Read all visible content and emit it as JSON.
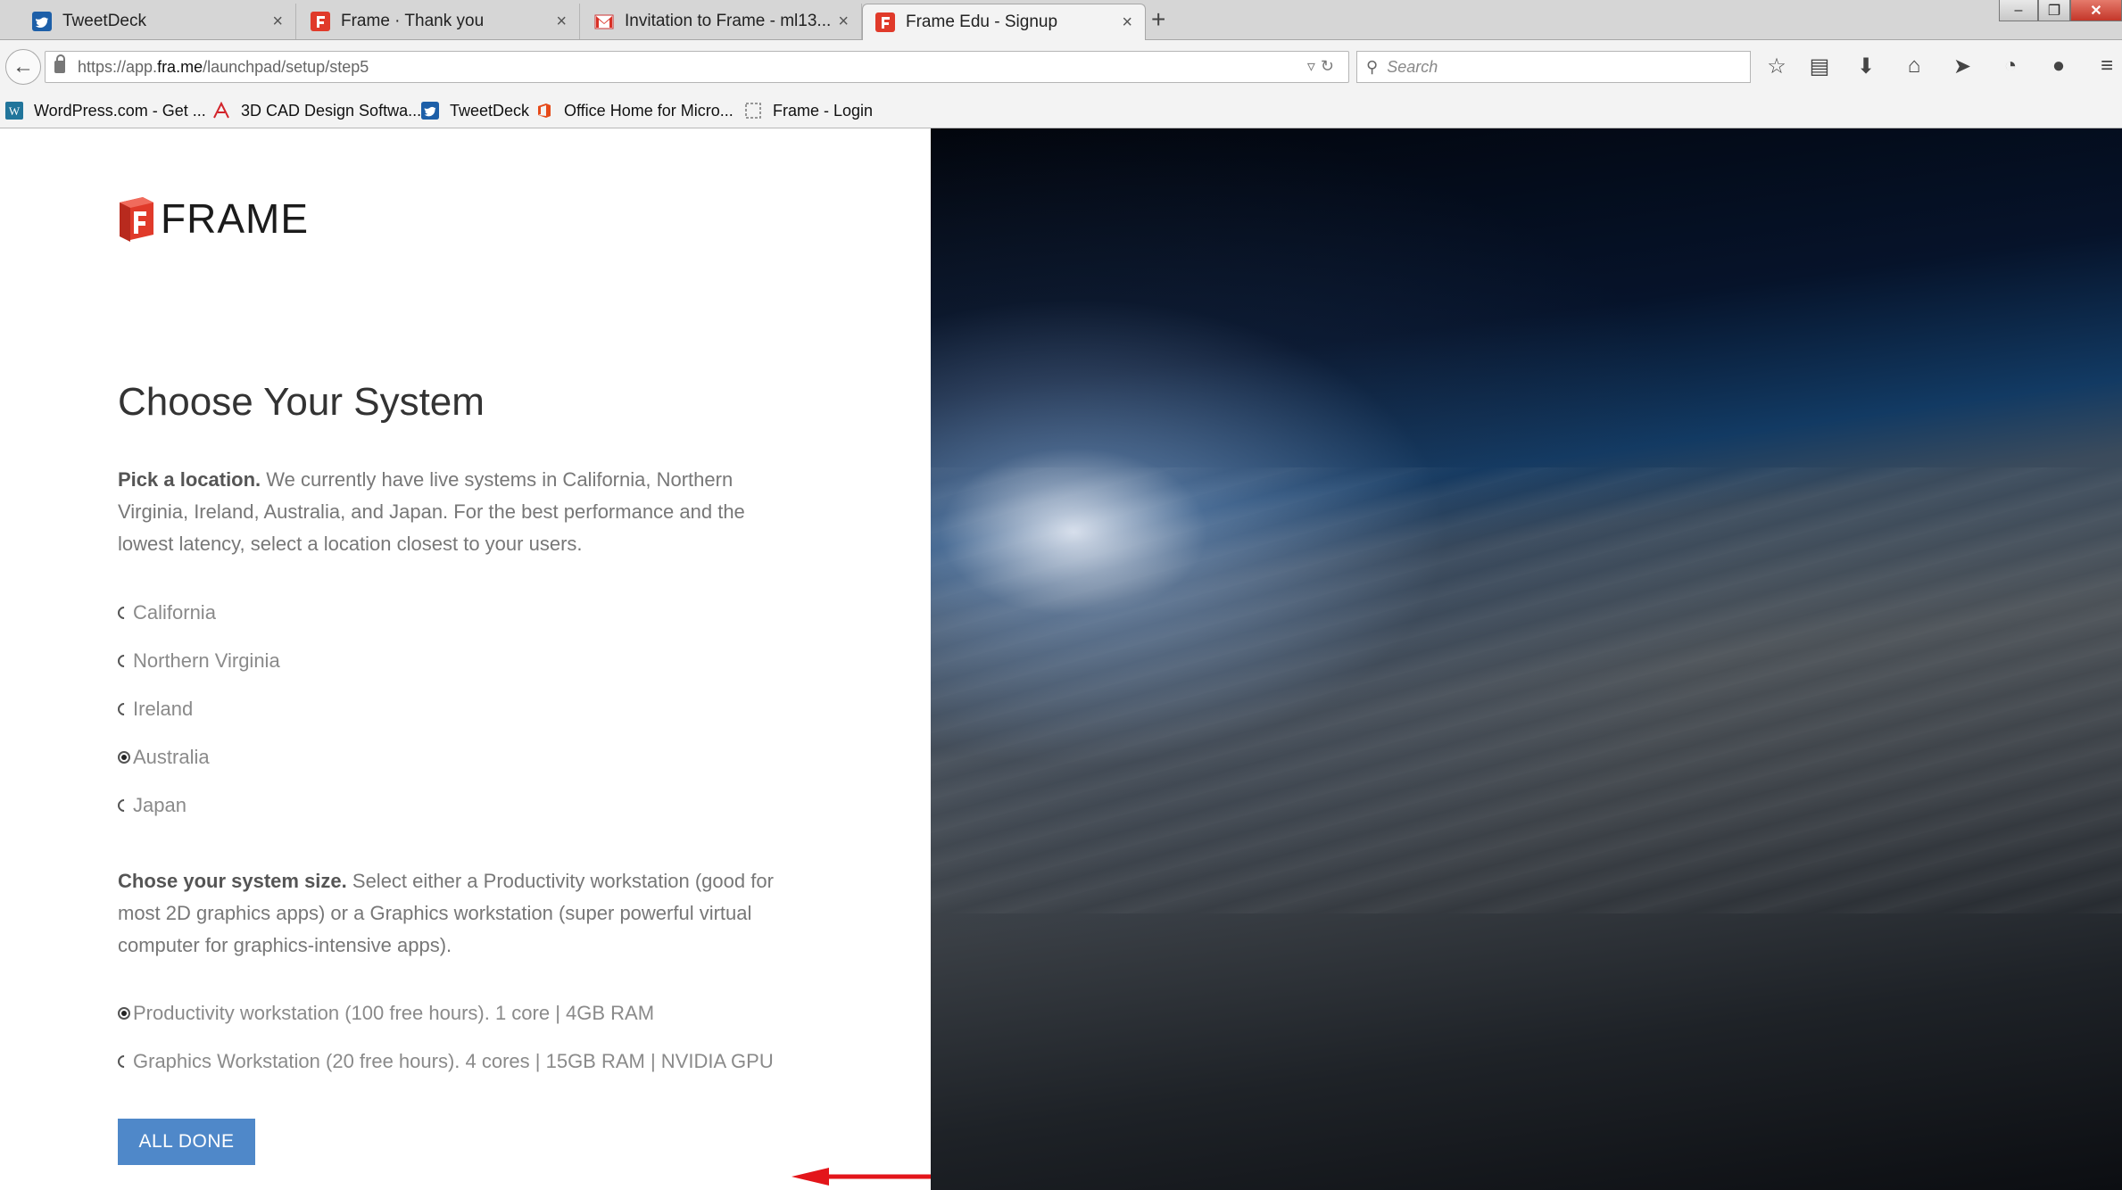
{
  "tabs": [
    {
      "label": "TweetDeck",
      "icon": "tweetdeck-icon",
      "active": false
    },
    {
      "label": "Frame · Thank you",
      "icon": "frame-icon",
      "active": false
    },
    {
      "label": "Invitation to Frame - ml13...",
      "icon": "gmail-icon",
      "active": false
    },
    {
      "label": "Frame Edu - Signup",
      "icon": "frame-icon",
      "active": true
    }
  ],
  "tab_close": "×",
  "new_tab": "+",
  "window_controls": {
    "minimize": "–",
    "restore": "❐",
    "close": "✕"
  },
  "navbar": {
    "url_prefix": "https://app.",
    "url_host": "fra.me",
    "url_path": "/launchpad/setup/step5",
    "search_placeholder": "Search"
  },
  "bookmarks": [
    {
      "label": "WordPress.com - Get ...",
      "icon": "wordpress-icon"
    },
    {
      "label": "3D CAD Design Softwa...",
      "icon": "autodesk-icon"
    },
    {
      "label": "TweetDeck",
      "icon": "tweetdeck-icon"
    },
    {
      "label": "Office Home for Micro...",
      "icon": "office-icon"
    },
    {
      "label": "Frame - Login",
      "icon": "page-icon"
    }
  ],
  "brand": {
    "logo_text": "FRAME",
    "logo_letter": "F",
    "accent": "#e03a2a",
    "button_color": "#4f88c9"
  },
  "page": {
    "title": "Choose Your System",
    "location_intro_bold": "Pick a location.",
    "location_intro_text": " We currently have live systems in California, Northern Virginia, Ireland, Australia, and Japan. For the best performance and the lowest latency, select a location closest to your users.",
    "locations": [
      {
        "label": "California",
        "checked": false
      },
      {
        "label": "Northern Virginia",
        "checked": false
      },
      {
        "label": "Ireland",
        "checked": false
      },
      {
        "label": "Australia",
        "checked": true
      },
      {
        "label": "Japan",
        "checked": false
      }
    ],
    "size_intro_bold": "Chose your system size.",
    "size_intro_text": " Select either a Productivity workstation (good for most 2D graphics apps) or a Graphics workstation (super powerful virtual computer for graphics-intensive apps).",
    "sizes": [
      {
        "label": "Productivity workstation (100 free hours). 1 core | 4GB RAM",
        "checked": true
      },
      {
        "label": "Graphics Workstation (20 free hours). 4 cores | 15GB RAM | NVIDIA GPU",
        "checked": false
      }
    ],
    "done_button": "ALL DONE"
  }
}
